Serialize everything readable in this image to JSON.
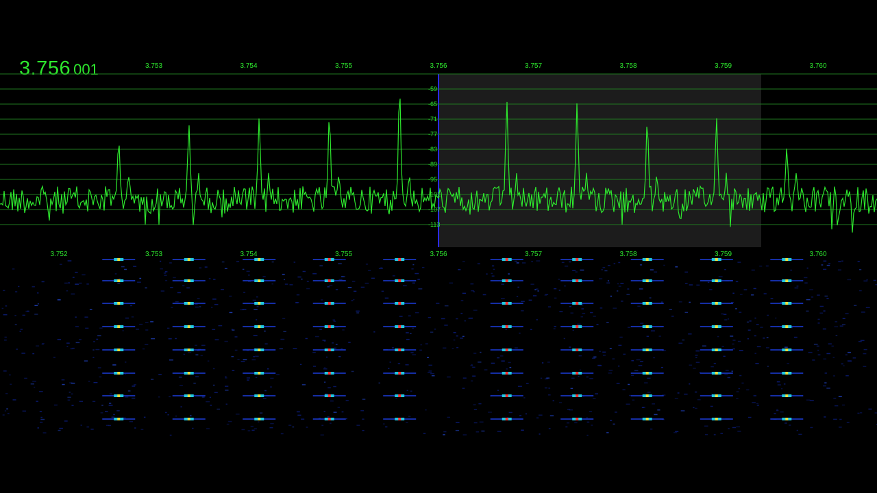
{
  "readout": {
    "freq_main": "3.756",
    "freq_sub": "001"
  },
  "spectrum": {
    "freq_labels": [
      "3.753",
      "3.754",
      "3.755",
      "3.756",
      "3.757",
      "3.758",
      "3.759",
      "3.760"
    ],
    "db_labels": [
      "-59",
      "-65",
      "-71",
      "-77",
      "-83",
      "-89",
      "-95",
      "-101",
      "-107",
      "-113"
    ],
    "peak_freqs": [
      3.75263,
      3.75337,
      3.75411,
      3.75485,
      3.75559,
      3.75672,
      3.75746,
      3.7582,
      3.75893,
      3.75967
    ]
  },
  "waterfall": {
    "freq_labels": [
      "3.752",
      "3.753",
      "3.754",
      "3.755",
      "3.756",
      "3.757",
      "3.758",
      "3.759",
      "3.760"
    ]
  },
  "colors": {
    "accent": "#2ee82e",
    "grid": "#1f7a1f",
    "passband": "#1c1c1c",
    "cursor": "#2a2aff",
    "waterfall_low": "#0a1a6e",
    "waterfall_mid": "#20c8e0",
    "waterfall_high": "#ff3030"
  }
}
